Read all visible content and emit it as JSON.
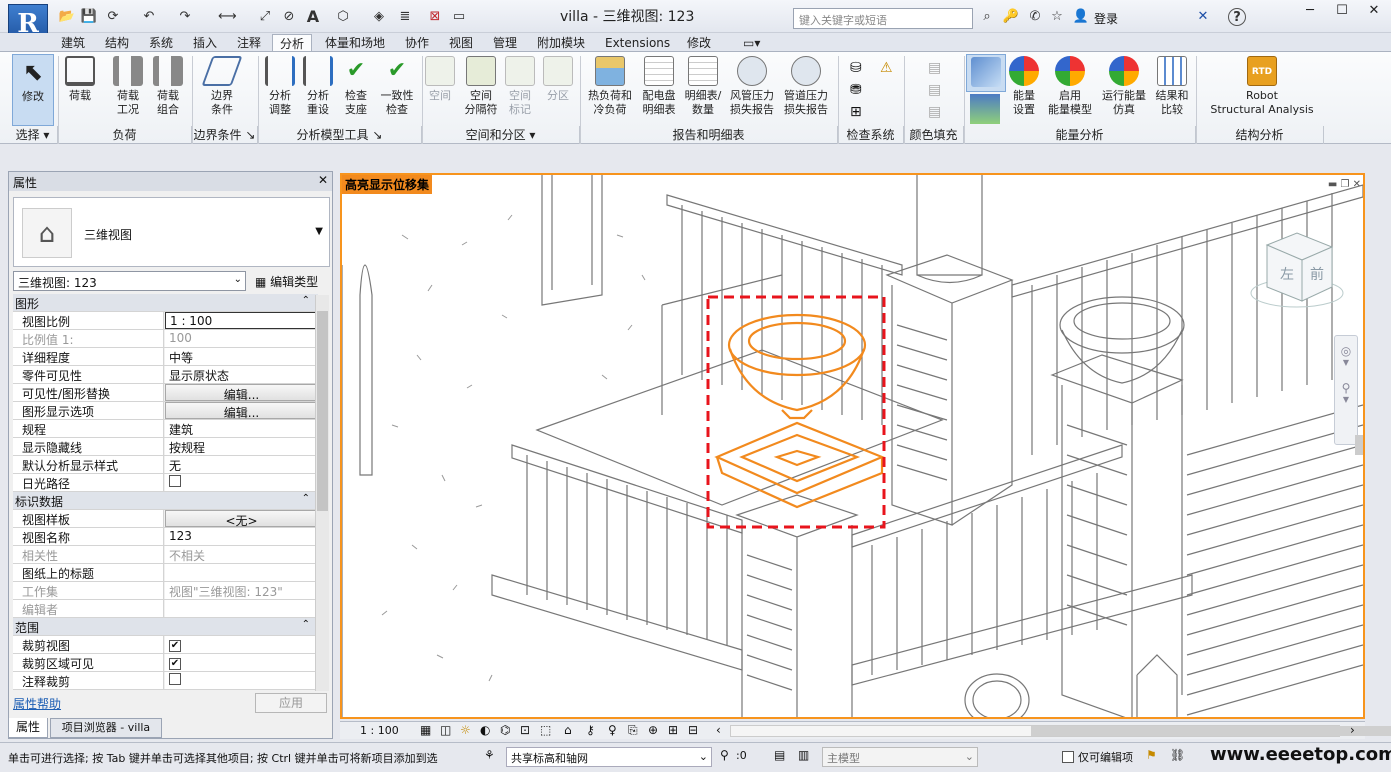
{
  "app": {
    "title": "villa - 三维视图: 123",
    "logo": "R"
  },
  "quick_access": {
    "icons": [
      "open-icon",
      "save-icon",
      "sync-icon",
      "undo-icon",
      "redo-icon",
      "measure-icon",
      "dimension-icon",
      "tag-icon",
      "text-icon",
      "3d-view-icon",
      "section-icon",
      "thin-lines-icon",
      "close-hidden-icon",
      "switch-windows-icon"
    ]
  },
  "search": {
    "placeholder": "键入关键字或短语"
  },
  "user": {
    "login": "登录"
  },
  "tabs": [
    "建筑",
    "结构",
    "系统",
    "插入",
    "注释",
    "分析",
    "体量和场地",
    "协作",
    "视图",
    "管理",
    "附加模块",
    "Extensions",
    "修改"
  ],
  "active_tab": "分析",
  "ribbon": {
    "buttons": [
      {
        "label": "修改",
        "name": "modify-button"
      },
      {
        "label": "荷载",
        "name": "loads-button"
      },
      {
        "label": "荷载\n工况",
        "name": "load-cases-button"
      },
      {
        "label": "荷载\n组合",
        "name": "load-combinations-button"
      },
      {
        "label": "边界\n条件",
        "name": "boundary-conditions-button"
      },
      {
        "label": "分析\n调整",
        "name": "analytical-adjust-button"
      },
      {
        "label": "分析\n重设",
        "name": "analytical-reset-button"
      },
      {
        "label": "检查\n支座",
        "name": "check-supports-button"
      },
      {
        "label": "一致性\n检查",
        "name": "consistency-check-button"
      },
      {
        "label": "空间",
        "name": "space-button"
      },
      {
        "label": "空间\n分隔符",
        "name": "space-separator-button"
      },
      {
        "label": "空间\n标记",
        "name": "space-tag-button"
      },
      {
        "label": "分区",
        "name": "zone-button"
      },
      {
        "label": "热负荷和\n冷负荷",
        "name": "heating-cooling-loads-button"
      },
      {
        "label": "配电盘\n明细表",
        "name": "panel-schedules-button"
      },
      {
        "label": "明细表/\n数量",
        "name": "schedule-quantities-button"
      },
      {
        "label": "风管压力\n损失报告",
        "name": "duct-pressure-loss-button"
      },
      {
        "label": "管道压力\n损失报告",
        "name": "pipe-pressure-loss-button"
      },
      {
        "label": "能量\n设置",
        "name": "energy-settings-button"
      },
      {
        "label": "启用\n能量模型",
        "name": "enable-energy-model-button"
      },
      {
        "label": "运行能量\n仿真",
        "name": "run-energy-simulation-button"
      },
      {
        "label": "结果和\n比较",
        "name": "results-compare-button"
      },
      {
        "label": "Robot\nStructural Analysis",
        "name": "robot-structural-analysis-button"
      }
    ],
    "panels": [
      "选择",
      "负荷",
      "边界条件",
      "分析模型工具",
      "空间和分区",
      "报告和明细表",
      "检查系统",
      "颜色填充",
      "能量分析",
      "结构分析"
    ]
  },
  "properties": {
    "title": "属性",
    "type_name": "三维视图",
    "view_selector": "三维视图: 123",
    "edit_type": "编辑类型",
    "groups": [
      {
        "name": "图形",
        "rows": [
          {
            "k": "视图比例",
            "v": "1 : 100",
            "style": "input"
          },
          {
            "k": "比例值 1:",
            "v": "100",
            "style": "dis"
          },
          {
            "k": "详细程度",
            "v": "中等"
          },
          {
            "k": "零件可见性",
            "v": "显示原状态"
          },
          {
            "k": "可见性/图形替换",
            "v": "编辑...",
            "style": "btn"
          },
          {
            "k": "图形显示选项",
            "v": "编辑...",
            "style": "btn"
          },
          {
            "k": "规程",
            "v": "建筑"
          },
          {
            "k": "显示隐藏线",
            "v": "按规程"
          },
          {
            "k": "默认分析显示样式",
            "v": "无"
          },
          {
            "k": "日光路径",
            "v": "",
            "style": "check",
            "checked": false
          }
        ]
      },
      {
        "name": "标识数据",
        "rows": [
          {
            "k": "视图样板",
            "v": "<无>",
            "style": "btn"
          },
          {
            "k": "视图名称",
            "v": "123"
          },
          {
            "k": "相关性",
            "v": "不相关",
            "style": "dis"
          },
          {
            "k": "图纸上的标题",
            "v": ""
          },
          {
            "k": "工作集",
            "v": "视图\"三维视图: 123\"",
            "style": "dis"
          },
          {
            "k": "编辑者",
            "v": "",
            "style": "dis"
          }
        ]
      },
      {
        "name": "范围",
        "rows": [
          {
            "k": "裁剪视图",
            "v": "",
            "style": "check",
            "checked": true
          },
          {
            "k": "裁剪区域可见",
            "v": "",
            "style": "check",
            "checked": true
          },
          {
            "k": "注释裁剪",
            "v": "",
            "style": "check",
            "checked": false
          }
        ]
      }
    ],
    "help": "属性帮助",
    "apply": "应用"
  },
  "bottom_tabs": [
    "属性",
    "项目浏览器 - villa"
  ],
  "viewport": {
    "highlight_label": "高亮显示位移集",
    "viewcube_left": "左",
    "viewcube_front": "前"
  },
  "viewbar": {
    "scale": "1 : 100"
  },
  "status": {
    "message": "单击可进行选择; 按 Tab 键并单击可选择其他项目; 按 Ctrl 键并单击可将新项目添加到选",
    "workset": "共享标高和轴网",
    "count": ":0",
    "model": "主模型",
    "editable_only": "仅可编辑项",
    "watermark": "www.eeeetop.com"
  },
  "colors": {
    "accent": "#f7941d",
    "highlight_box": "#e8141c",
    "selection_orange": "#f28a1e"
  }
}
